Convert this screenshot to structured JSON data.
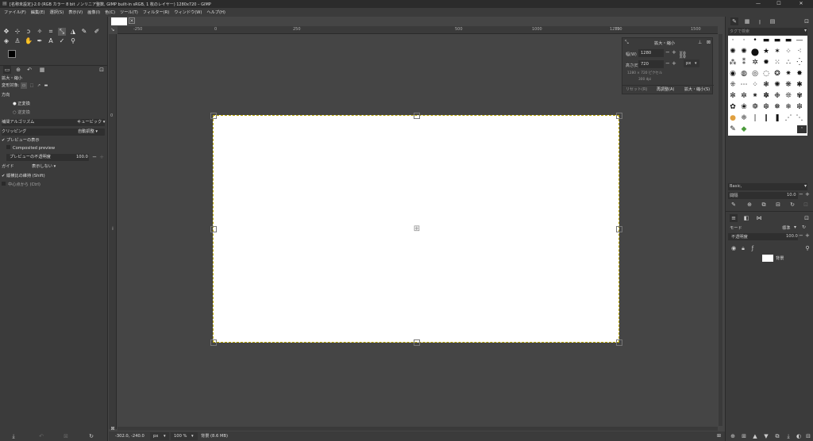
{
  "window": {
    "title": "[名称未設定]-2.0 (RGB カラー 8 bit ノンリニア整数, GIMP built-in sRGB, 1 枚のレイヤー) 1280x720 – GIMP",
    "minimize": "—",
    "maximize": "☐",
    "close": "✕"
  },
  "menu": [
    "ファイル(F)",
    "編集(E)",
    "選択(S)",
    "表示(V)",
    "画像(I)",
    "色(C)",
    "ツール(T)",
    "フィルター(R)",
    "ウィンドウ(W)",
    "ヘルプ(H)"
  ],
  "tool_options": {
    "title": "拡大・縮小",
    "transform_label": "変形対象:",
    "direction_label": "方向",
    "direction_normal": "正変換",
    "direction_reverse": "逆変換",
    "interpolation_label": "補間アルゴリズム",
    "interpolation_value": "キュービック",
    "clipping_label": "クリッピング",
    "clipping_value": "自動調整",
    "show_preview": "プレビューの表示",
    "composited_preview": "Composited preview",
    "preview_opacity_label": "プレビューの不透明度",
    "preview_opacity_value": "100.0",
    "guides_label": "ガイド",
    "guides_value": "表示しない",
    "keep_aspect": "縦横比の維持 (Shift)",
    "from_center": "中心点から (Ctrl)"
  },
  "ruler": {
    "h_labels": [
      "-250",
      "0",
      "250",
      "500",
      "750",
      "1000",
      "1250",
      "1500"
    ],
    "v_labels": [
      "0"
    ]
  },
  "scale_dialog": {
    "title": "拡大・縮小",
    "width_label": "幅(W)",
    "width_value": "1280",
    "height_label": "高さ(E)",
    "height_value": "720",
    "unit": "px",
    "size_info": "1280 × 720 ピクセル",
    "dpi_info": "300 dpi",
    "reset_button": "リセット(R)",
    "readjust_button": "再調整(A)",
    "scale_button": "拡大・縮小(S)"
  },
  "status": {
    "coords": "-302.0, -240.0",
    "unit": "px",
    "zoom": "100 %",
    "info": "背景 (8.6 MB)"
  },
  "right_panel": {
    "tag_search_placeholder": "タグで検索",
    "brush_name": "Basic,",
    "spacing_label": "間隔",
    "spacing_value": "10.0",
    "mode_label": "モード",
    "mode_value": "標準",
    "opacity_label": "不透明度",
    "opacity_value": "100.0",
    "layer_name": "背景"
  }
}
